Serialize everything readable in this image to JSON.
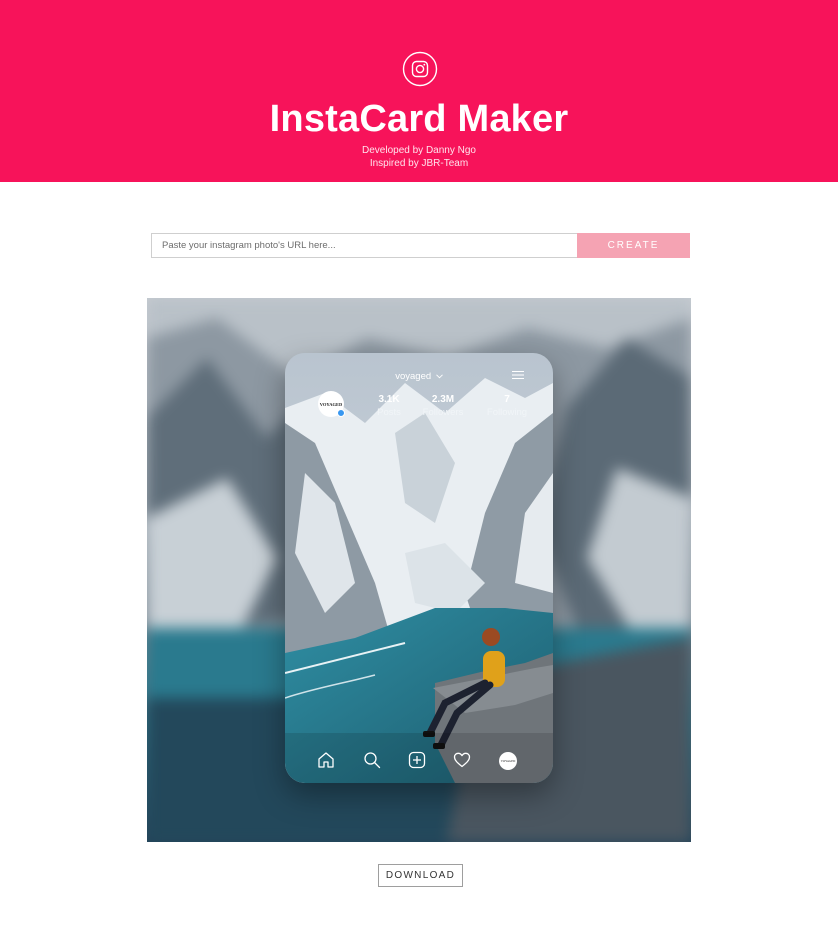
{
  "header": {
    "logo_icon": "instagram-icon",
    "title": "InstaCard Maker",
    "developed_by": "Developed by Danny Ngo",
    "inspired_by": "Inspired by JBR-Team",
    "background_color": "#f7135a"
  },
  "form": {
    "url_placeholder": "Paste your instagram photo's URL here...",
    "url_value": "",
    "create_label": "CREATE",
    "create_color": "#f5a3b3"
  },
  "card": {
    "profile": {
      "username": "voyaged",
      "username_dropdown_icon": "chevron-down-icon",
      "menu_icon": "hamburger-icon",
      "avatar_text": "VOYAGED",
      "verified_icon": "verified-badge-icon"
    },
    "stats": [
      {
        "value": "3.1K",
        "label": "Posts"
      },
      {
        "value": "2.3M",
        "label": "Followers"
      },
      {
        "value": "7",
        "label": "Following"
      }
    ],
    "nav_icons": [
      "home-icon",
      "search-icon",
      "add-post-icon",
      "heart-icon",
      "profile-avatar"
    ],
    "profile_avatar_text": "VOYAGED"
  },
  "download": {
    "label": "DOWNLOAD"
  }
}
